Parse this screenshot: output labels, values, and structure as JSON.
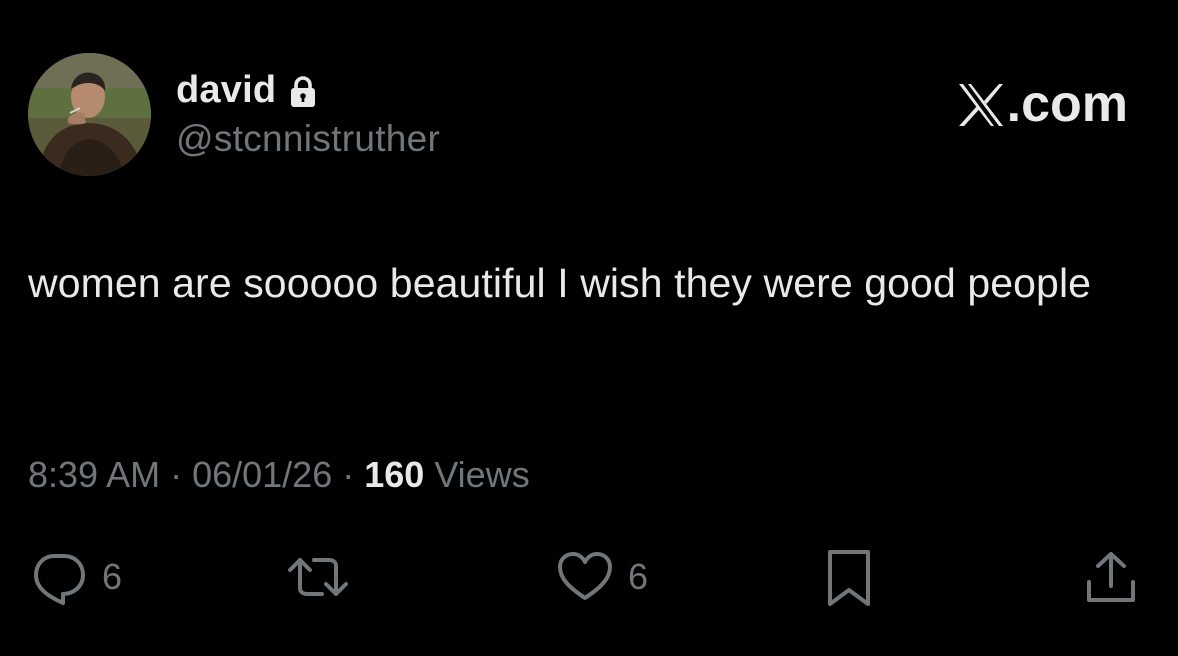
{
  "tweet": {
    "author": {
      "display_name": "david",
      "handle": "@stcnnistruther",
      "avatar_icon": "profile-photo",
      "lock_icon": "lock-icon"
    },
    "brand": {
      "label": ".com",
      "icon": "x-logo-icon"
    },
    "text": "women are sooooo beautiful I wish they were good people",
    "meta": {
      "time": "8:39 AM",
      "separator": "·",
      "date": "06/01/26",
      "views_count": "160",
      "views_label": "Views"
    },
    "actions": {
      "reply_count": "6",
      "like_count": "6",
      "reply_icon": "reply-icon",
      "retweet_icon": "retweet-icon",
      "like_icon": "heart-icon",
      "bookmark_icon": "bookmark-icon",
      "share_icon": "share-icon"
    }
  },
  "colors": {
    "background": "#000000",
    "primary_text": "#e7e9ea",
    "secondary_text": "#71767b"
  }
}
